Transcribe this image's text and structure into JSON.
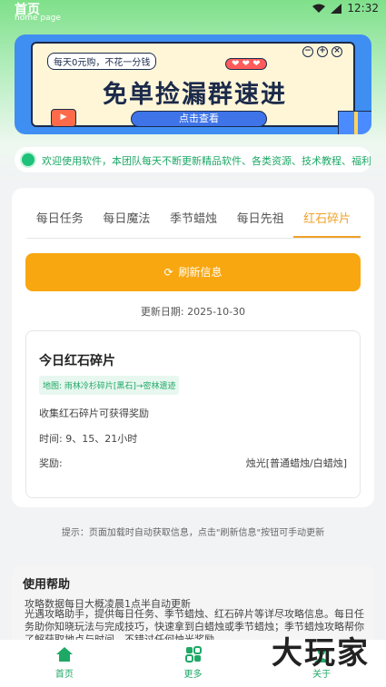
{
  "status": {
    "time": "12:32"
  },
  "header": {
    "title": "首页",
    "subtitle": "home page"
  },
  "banner": {
    "tag": "每天0元购，不花一分钱",
    "hearts": "❤ ❤ ❤",
    "title": "免单捡漏群速进",
    "button": "点击查看",
    "play": "▶"
  },
  "notice": {
    "text": "欢迎使用软件，本团队每天不断更新精品软件、各类资源、技术教程、福利活动、电影"
  },
  "tabs": [
    "每日任务",
    "每日魔法",
    "季节蜡烛",
    "每日先祖",
    "红石碎片"
  ],
  "active_tab_index": 4,
  "refresh": {
    "label": "刷新信息"
  },
  "update_date": "更新日期: 2025-10-30",
  "shards": {
    "title": "今日红石碎片",
    "map": "地图: 雨林冷杉碎片[黑石]→密林遗迹",
    "desc": "收集红石碎片可获得奖励",
    "time": "时间: 9、15、21小时",
    "reward_label": "奖励:",
    "reward_value": "烛光[普通蜡烛/白蜡烛]"
  },
  "tip": "提示：页面加载时自动获取信息，点击\"刷新信息\"按钮可手动更新",
  "help": {
    "title": "使用帮助",
    "line1": "攻略数据每日大概凌晨1点半自动更新",
    "body": "光遇攻略助手，提供每日任务、季节蜡烛、红石碎片等详尽攻略信息。每日任务助你知晓玩法与完成技巧，快速拿到白蜡烛或季节蜡烛；季节蜡烛攻略帮你了解获取地点与时间，不错过任何烛光奖励..."
  },
  "tabbar": [
    {
      "label": "首页",
      "icon": "home-icon"
    },
    {
      "label": "更多",
      "icon": "more-icon"
    },
    {
      "label": "关于",
      "icon": "about-icon"
    }
  ],
  "watermark": "大玩家",
  "colors": {
    "accent": "#f8a710",
    "green": "#1ea866",
    "banner_blue": "#3f8ef2"
  }
}
